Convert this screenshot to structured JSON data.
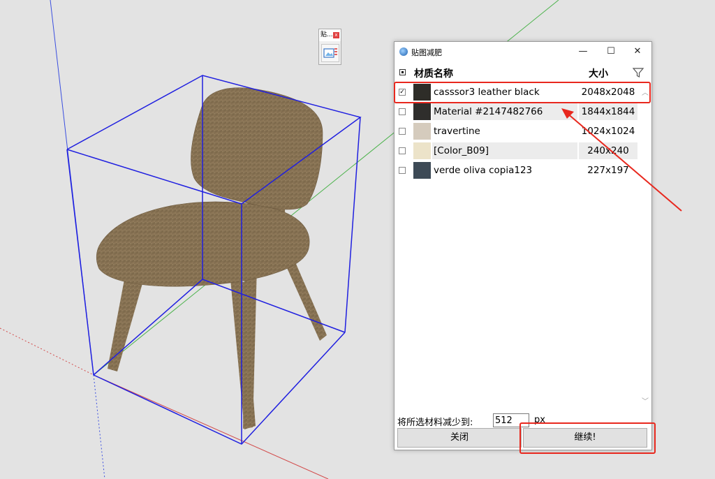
{
  "toolbar": {
    "title": "贴...",
    "close_glyph": "x",
    "button_icon": "image-list-icon"
  },
  "dialog": {
    "title": "贴图减肥",
    "window_buttons": {
      "minimize": "—",
      "maximize": "☐",
      "close": "✕"
    }
  },
  "table": {
    "header": {
      "name": "材质名称",
      "size": "大小"
    },
    "rows": [
      {
        "checked": true,
        "check_glyph": "✓",
        "color": "#2e2d28",
        "name": "casssor3 leather black",
        "size": "2048x2048"
      },
      {
        "checked": false,
        "check_glyph": "",
        "color": "#2f2e2c",
        "name": "Material #2147482766",
        "size": "1844x1844"
      },
      {
        "checked": false,
        "check_glyph": "",
        "color": "#d5cbbd",
        "name": "travertine",
        "size": "1024x1024"
      },
      {
        "checked": false,
        "check_glyph": "",
        "color": "#ece3c9",
        "name": "[Color_B09]",
        "size": "240x240"
      },
      {
        "checked": false,
        "check_glyph": "",
        "color": "#3d4a56",
        "name": "verde oliva copia123",
        "size": "227x197"
      }
    ]
  },
  "reduce": {
    "label": "将所选材料减少到:",
    "value": "512",
    "unit": "px"
  },
  "buttons": {
    "close": "关闭",
    "continue": "继续!"
  },
  "colors": {
    "annotation": "#e8281e",
    "bbox": "#1f1fe0",
    "wood": "#8b7556",
    "axis_blue": "#3a4ee0",
    "axis_green": "#4cb34c",
    "axis_red": "#d24a4a"
  }
}
